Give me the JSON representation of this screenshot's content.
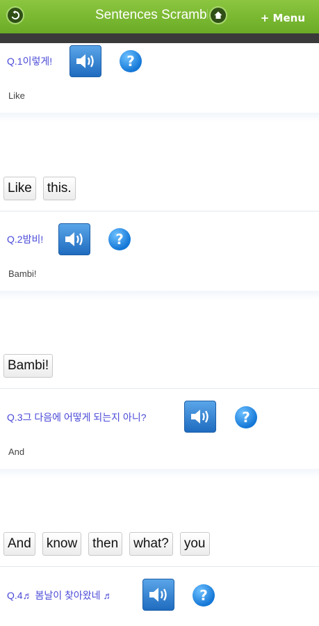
{
  "header": {
    "title": "Sentences Scramble",
    "menu_label": "+ Menu",
    "back_icon": "back-arrow-icon",
    "home_icon": "home-icon"
  },
  "questions": [
    {
      "number": "Q.1",
      "text": "이렇게!",
      "hint": "Like",
      "words": [
        "Like",
        "this."
      ]
    },
    {
      "number": "Q.2",
      "text": "밤비!",
      "hint": "Bambi!",
      "words": [
        "Bambi!"
      ]
    },
    {
      "number": "Q.3",
      "text": "그 다음에 어떻게 되는지 아니?",
      "hint": "And",
      "words": [
        "And",
        "know",
        "then",
        "what?",
        "you"
      ]
    },
    {
      "number": "Q.4",
      "text": "♬ 봄날이 찾아왔네 ♬",
      "hint": "",
      "words": []
    }
  ],
  "colors": {
    "header_green": "#7bbb32",
    "question_text": "#4a4ad8",
    "speaker_blue": "#2f7fd0"
  }
}
